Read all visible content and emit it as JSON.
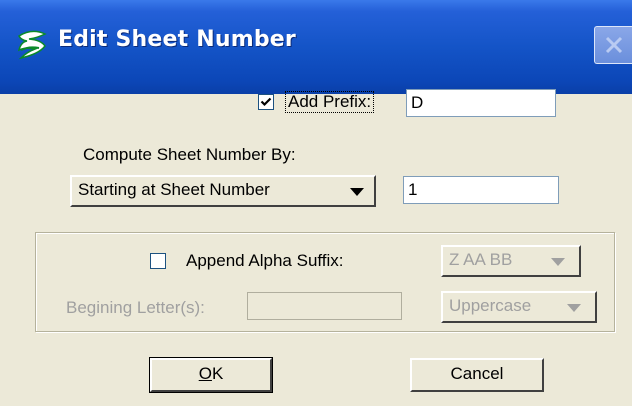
{
  "window": {
    "title": "Edit Sheet Number"
  },
  "prefix": {
    "checked": true,
    "label": "Add Prefix:",
    "value": "D"
  },
  "compute": {
    "label": "Compute Sheet Number By:",
    "method": "Starting at Sheet Number",
    "start_value": "1"
  },
  "suffix": {
    "checked": false,
    "label": "Append Alpha Suffix:",
    "style": "Z AA BB",
    "begin_label": "Begining Letter(s):",
    "begin_value": "",
    "case": "Uppercase"
  },
  "buttons": {
    "ok_access": "O",
    "ok_rest": "K",
    "cancel": "Cancel"
  }
}
